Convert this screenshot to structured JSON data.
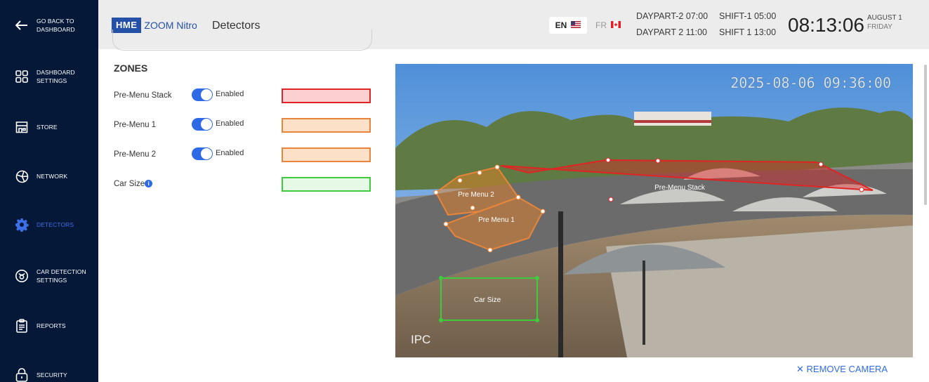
{
  "sidebar": {
    "back": "GO BACK TO DASHBOARD",
    "items": [
      {
        "label": "DASHBOARD SETTINGS",
        "icon": "dashboard-grid-icon"
      },
      {
        "label": "STORE",
        "icon": "store-icon"
      },
      {
        "label": "NETWORK",
        "icon": "network-icon"
      },
      {
        "label": "DETECTORS",
        "icon": "gear-icon",
        "active": true
      },
      {
        "label": "CAR DETECTION SETTINGS",
        "icon": "car-detection-icon"
      },
      {
        "label": "REPORTS",
        "icon": "clipboard-icon"
      },
      {
        "label": "SECURITY",
        "icon": "lock-icon"
      }
    ]
  },
  "header": {
    "brand": "HME",
    "product": "ZOOM Nitro",
    "title": "Detectors",
    "lang_en": "EN",
    "lang_fr": "FR",
    "daypart1": "DAYPART-2 07:00",
    "daypart2": "DAYPART 2 11:00",
    "shift1": "SHIFT-1 05:00",
    "shift2": "SHIFT 1 13:00",
    "time": "08:13:06",
    "date": "AUGUST 1",
    "weekday": "FRIDAY"
  },
  "zones": {
    "title": "ZONES",
    "items": [
      {
        "name": "Pre-Menu Stack",
        "toggle": "Enabled",
        "enabled": true,
        "border": "#e02424",
        "fill": "#fcd0d0"
      },
      {
        "name": "Pre-Menu 1",
        "toggle": "Enabled",
        "enabled": true,
        "border": "#e8853a",
        "fill": "#fde0c8"
      },
      {
        "name": "Pre-Menu 2",
        "toggle": "Enabled",
        "enabled": true,
        "border": "#e8853a",
        "fill": "#fde0c8"
      },
      {
        "name": "Car Size",
        "toggle": "",
        "enabled": null,
        "border": "#3ccc3c",
        "fill": "#e6f8e6"
      }
    ]
  },
  "camera": {
    "timestamp": "2025-08-06 09:36:00",
    "channel": "IPC",
    "zone_labels": [
      "Pre-Menu Stack",
      "Pre Menu 2",
      "Pre Menu 1",
      "Car Size"
    ]
  },
  "remove_camera": "REMOVE CAMERA",
  "colors": {
    "sidebar": "#051838",
    "accent": "#2f6ae6",
    "header": "#ececec"
  }
}
